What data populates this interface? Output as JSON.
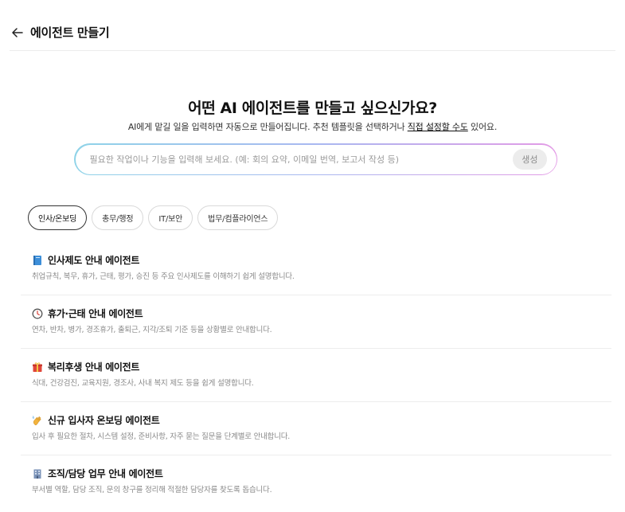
{
  "header": {
    "title": "에이전트 만들기"
  },
  "hero": {
    "title": "어떤 AI 에이전트를 만들고 싶으신가요?",
    "subtitle_before": "AI에게 맡길 일을 입력하면 자동으로 만들어집니다. 추천 템플릿을 선택하거나 ",
    "subtitle_link": "직접 설정할 수도",
    "subtitle_after": " 있어요."
  },
  "prompt": {
    "placeholder": "필요한 작업이나 기능을 입력해 보세요. (예: 회의 요약, 이메일 번역, 보고서 작성 등)",
    "value": "",
    "generate_label": "생성"
  },
  "categories": [
    {
      "label": "인사/온보딩",
      "active": true
    },
    {
      "label": "총무/행정",
      "active": false
    },
    {
      "label": "IT/보안",
      "active": false
    },
    {
      "label": "법무/컴플라이언스",
      "active": false
    }
  ],
  "agents": [
    {
      "icon": "book-icon",
      "title": "인사제도 안내 에이전트",
      "description": "취업규칙, 복무, 휴가, 근태, 평가, 승진 등 주요 인사제도를 이해하기 쉽게 설명합니다."
    },
    {
      "icon": "clock-icon",
      "title": "휴가·근태 안내 에이전트",
      "description": "연차, 반차, 병가, 경조휴가, 출퇴근, 지각/조퇴 기준 등을 상황별로 안내합니다."
    },
    {
      "icon": "gift-icon",
      "title": "복리후생 안내 에이전트",
      "description": "식대, 건강검진, 교육지원, 경조사, 사내 복지 제도 등을 쉽게 설명합니다."
    },
    {
      "icon": "waving-hand-icon",
      "title": "신규 입사자 온보딩 에이전트",
      "description": "입사 후 필요한 절차, 시스템 설정, 준비사항, 자주 묻는 질문을 단계별로 안내합니다."
    },
    {
      "icon": "office-building-icon",
      "title": "조직/담당 업무 안내 에이전트",
      "description": "부서별 역할, 담당 조직, 문의 창구를 정리해 적절한 담당자를 찾도록 돕습니다."
    }
  ],
  "colors": {
    "book": "#3d8fd9",
    "gift": "#e0463a",
    "hand": "#f2b33d",
    "building": "#7b93b8"
  }
}
